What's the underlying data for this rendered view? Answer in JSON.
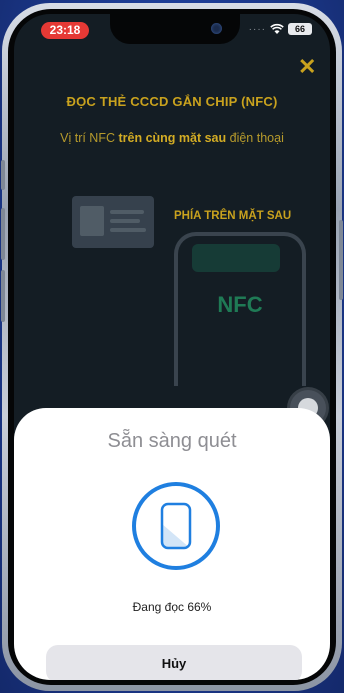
{
  "status_bar": {
    "time": "23:18",
    "battery": "66",
    "signal": "····"
  },
  "screen": {
    "close_icon": "close-icon",
    "title": "ĐỌC THẺ CCCD GẮN CHIP (NFC)",
    "subtitle": {
      "before": "Vị trí NFC ",
      "bold": "trên cùng mặt sau",
      "after": " điện thoại"
    },
    "back_label": "PHÍA TRÊN MẶT SAU",
    "nfc_label": "NFC"
  },
  "sheet": {
    "title": "Sẵn sàng quét",
    "progress_text": "Đang đọc 66%",
    "progress_fraction": 0.66,
    "cancel_label": "Hủy"
  },
  "colors": {
    "accent_gold": "#c9a21e",
    "scan_blue": "#1f7fe0",
    "time_pill_red": "#e53935",
    "nfc_green": "#1f7a55"
  }
}
